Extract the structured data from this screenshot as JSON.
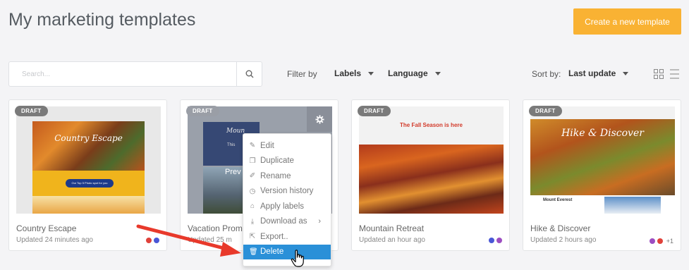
{
  "header": {
    "title": "My marketing templates",
    "create_button": "Create a new template"
  },
  "toolbar": {
    "search_placeholder": "Search...",
    "filter_label": "Filter by",
    "labels_dropdown": "Labels",
    "language_dropdown": "Language",
    "sort_label": "Sort by:",
    "sort_value": "Last update"
  },
  "cards": [
    {
      "badge": "DRAFT",
      "title": "Country Escape",
      "updated": "Updated 24 minutes ago",
      "thumb_heading": "Country Escape",
      "thumb_button": "Our Top 5 Photo spot for you",
      "dots": [
        "#e0413a",
        "#4a57d6"
      ],
      "extra": ""
    },
    {
      "badge": "DRAFT",
      "title": "Vacation Prom",
      "updated": "Updated 25 m",
      "thumb_heading": "Moun",
      "thumb_sub": "This",
      "thumb_overlay": "Prev",
      "dots": [],
      "extra": ""
    },
    {
      "badge": "DRAFT",
      "title": "Mountain Retreat",
      "updated": "Updated an hour ago",
      "thumb_heading": "The Fall Season is here",
      "dots": [
        "#4a57d6",
        "#9c4dc1"
      ],
      "extra": ""
    },
    {
      "badge": "DRAFT",
      "title": "Hike & Discover",
      "updated": "Updated 2 hours ago",
      "thumb_heading": "Hike & Discover",
      "thumb_caption": "Mount Everest",
      "dots": [
        "#9c4dc1",
        "#e0413a"
      ],
      "extra": "+1"
    }
  ],
  "context_menu": {
    "items": [
      {
        "label": "Edit",
        "icon": "pencil-icon",
        "glyph": "✎"
      },
      {
        "label": "Duplicate",
        "icon": "copy-icon",
        "glyph": "❐"
      },
      {
        "label": "Rename",
        "icon": "rename-icon",
        "glyph": "✐"
      },
      {
        "label": "Version history",
        "icon": "history-icon",
        "glyph": "◷"
      },
      {
        "label": "Apply labels",
        "icon": "tag-icon",
        "glyph": "⌂"
      },
      {
        "label": "Download as",
        "icon": "download-icon",
        "glyph": "⤓"
      },
      {
        "label": "Export..",
        "icon": "export-icon",
        "glyph": "⇱"
      },
      {
        "label": "Delete",
        "icon": "trash-icon",
        "glyph": "🗑"
      }
    ],
    "submenu_glyph": "›"
  },
  "colors": {
    "accent": "#f9b233",
    "menu_highlight": "#2a90d8",
    "annotation_arrow": "#e8392b"
  }
}
